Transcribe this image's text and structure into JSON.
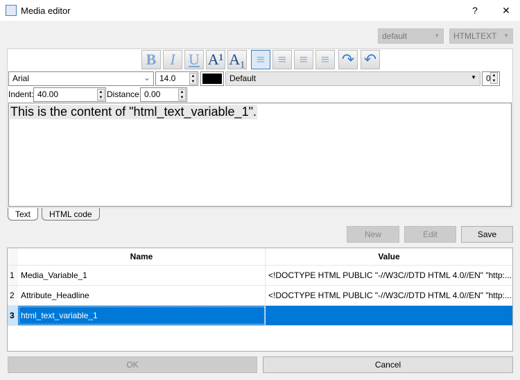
{
  "window": {
    "title": "Media editor",
    "help": "?",
    "close": "✕"
  },
  "combos": {
    "style": "default",
    "type": "HTMLTEXT"
  },
  "toolbar": {
    "buttons": [
      "B",
      "I",
      "U",
      "A¹",
      "A₁",
      "≡",
      "≡",
      "≡",
      "≡",
      "↷",
      "↶"
    ]
  },
  "font": {
    "family": "Arial",
    "size": "14.0",
    "color": "#000000",
    "style": "Default",
    "spacing": "0"
  },
  "indent": {
    "label": "Indent:",
    "value": "40.00",
    "distance_label": "Distance:",
    "distance_value": "0.00"
  },
  "editor": {
    "content": "This is the content of \"html_text_variable_1\"."
  },
  "tabs": [
    "Text",
    "HTML code"
  ],
  "actions": {
    "new": "New",
    "edit": "Edit",
    "save": "Save"
  },
  "table": {
    "headers": [
      "Name",
      "Value"
    ],
    "rows": [
      {
        "n": "1",
        "name": "Media_Variable_1",
        "value": "<!DOCTYPE HTML PUBLIC \"-//W3C//DTD HTML 4.0//EN\" \"http:..."
      },
      {
        "n": "2",
        "name": "Attribute_Headline",
        "value": "<!DOCTYPE HTML PUBLIC \"-//W3C//DTD HTML 4.0//EN\" \"http:..."
      },
      {
        "n": "3",
        "name": "html_text_variable_1",
        "value": ""
      }
    ]
  },
  "footer": {
    "ok": "OK",
    "cancel": "Cancel"
  }
}
